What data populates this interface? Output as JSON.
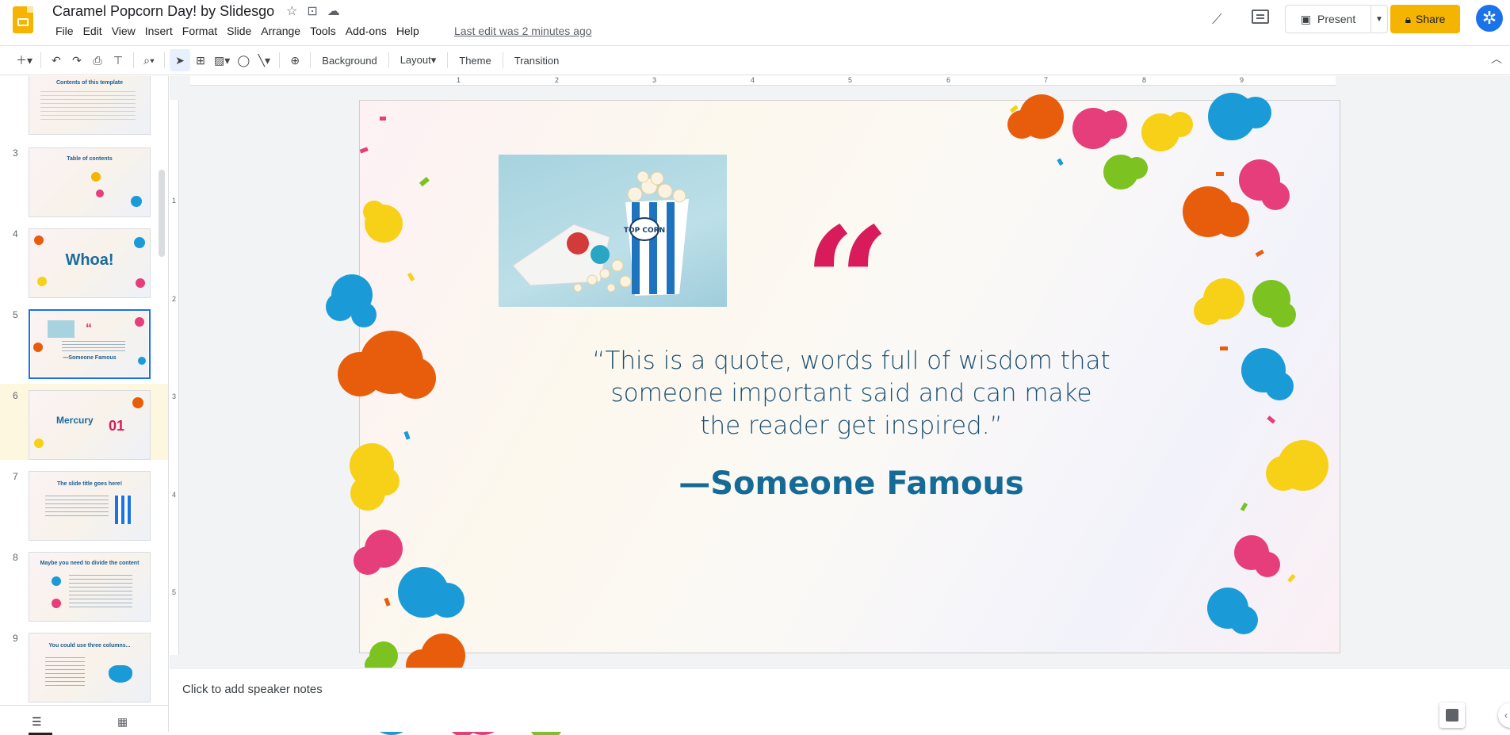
{
  "app": {
    "doc_title": "Caramel Popcorn Day! by Slidesgo",
    "last_edit": "Last edit was 2 minutes ago",
    "menu": [
      "File",
      "Edit",
      "View",
      "Insert",
      "Format",
      "Slide",
      "Arrange",
      "Tools",
      "Add-ons",
      "Help"
    ],
    "present_label": "Present",
    "share_label": "Share"
  },
  "toolbar": {
    "background": "Background",
    "layout": "Layout",
    "theme": "Theme",
    "transition": "Transition"
  },
  "ruler": {
    "h": [
      "1",
      "2",
      "3",
      "4",
      "5",
      "6",
      "7",
      "8",
      "9"
    ],
    "v": [
      "1",
      "2",
      "3",
      "4",
      "5"
    ]
  },
  "filmstrip": {
    "slides": [
      {
        "num": "",
        "title": "Contents of this template"
      },
      {
        "num": "3",
        "title": "Table of contents"
      },
      {
        "num": "4",
        "title": "Whoa!"
      },
      {
        "num": "5",
        "title": "—Someone Famous"
      },
      {
        "num": "6",
        "title": "Mercury",
        "extra": "01"
      },
      {
        "num": "7",
        "title": "The slide title goes here!"
      },
      {
        "num": "8",
        "title": "Maybe you need to divide the content"
      },
      {
        "num": "9",
        "title": "You could use three columns..."
      }
    ]
  },
  "slide": {
    "quote_mark": "“",
    "quote": "“This is a quote, words full of wisdom that someone important said and can make the reader get inspired.”",
    "author": "—Someone Famous",
    "photo_caption": "TOP CORN"
  },
  "notes": {
    "placeholder": "Click to add speaker notes"
  },
  "colors": {
    "accent": "#f4b400",
    "quote_pink": "#d81b5a",
    "text_blue": "#1b4f6e",
    "author_blue": "#166b96"
  }
}
